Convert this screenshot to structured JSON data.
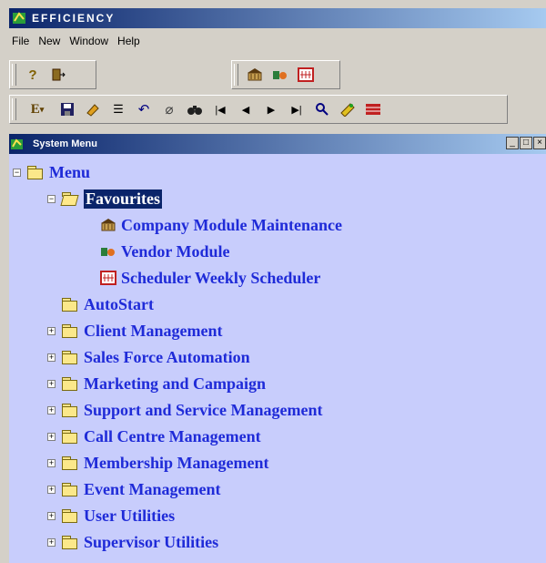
{
  "app": {
    "title": "EFFICIENCY"
  },
  "menubar": {
    "items": [
      "File",
      "New",
      "Window",
      "Help"
    ]
  },
  "toolbar1": {
    "icons": [
      "help-icon",
      "exit-icon",
      "company-icon",
      "vendor-icon",
      "scheduler-icon"
    ]
  },
  "toolbar2": {
    "icons": [
      "format-dropdown-icon",
      "save-icon",
      "clear-icon",
      "list-icon",
      "undo-icon",
      "erase-icon",
      "find-icon",
      "first-record-icon",
      "previous-record-icon",
      "next-record-icon",
      "last-record-icon",
      "lookup-icon",
      "attach-icon",
      "delete-icon"
    ]
  },
  "system_menu": {
    "title": "System Menu",
    "controls": [
      "_",
      "□",
      "×"
    ],
    "tree": {
      "root": "Menu",
      "favourites": {
        "label": "Favourites",
        "children": [
          "Company Module Maintenance",
          "Vendor Module",
          "Scheduler Weekly Scheduler"
        ]
      },
      "items": [
        "AutoStart",
        "Client Management",
        "Sales Force Automation",
        "Marketing and Campaign",
        "Support and Service Management",
        "Call Centre Management",
        "Membership Management",
        "Event Management",
        "User Utilities",
        "Supervisor Utilities"
      ]
    }
  },
  "colors": {
    "tree_bg": "#c8cdfc",
    "tree_text": "#1f2bd8",
    "selected_bg": "#0a246a",
    "titlebar": "#0a246a"
  }
}
